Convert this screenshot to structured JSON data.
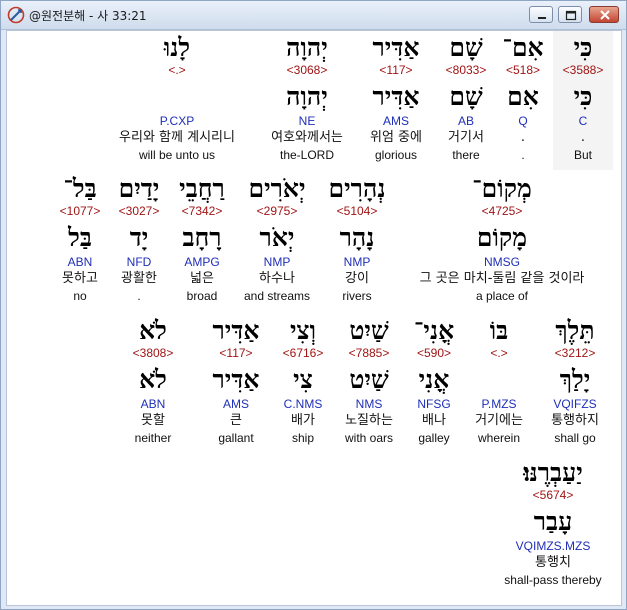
{
  "window": {
    "title": "@원전분해 - 사 33:21"
  },
  "verse": [
    {
      "cols": [
        {
          "heb": "כִּי",
          "strong": "<3588>",
          "heb2": "כִּי",
          "parse": "C",
          "kor": ".",
          "eng": "But"
        },
        {
          "heb": "אִם־",
          "strong": "<518>",
          "heb2": "אִם",
          "parse": "Q",
          "kor": ".",
          "eng": "."
        },
        {
          "heb": "שָׁם",
          "strong": "<8033>",
          "heb2": "שָׁם",
          "parse": "AB",
          "kor": "거기서",
          "eng": "there"
        },
        {
          "heb": "אַדִּיר",
          "strong": "<117>",
          "heb2": "אַדִּיר",
          "parse": "AMS",
          "kor": "위엄 중에",
          "eng": "glorious"
        },
        {
          "heb": "יְהוָה",
          "strong": "<3068>",
          "heb2": "יְהוָה",
          "parse": "NE",
          "kor": "여호와께서는",
          "eng": "the-LORD"
        },
        {
          "heb": "לָנוּ",
          "strong": "<.>",
          "heb2": "",
          "parse": "P.CXP",
          "kor": "우리와 함께 계시리니",
          "eng": "will be unto us"
        }
      ]
    },
    {
      "cols": [
        {
          "heb": "מְקוֹם־",
          "strong": "<4725>",
          "heb2": "מָקוֹם",
          "parse": "NMSG",
          "kor": "그 곳은 마치-둘림 같을 것이라",
          "eng": "a place of"
        },
        {
          "heb": "נְהָרִים",
          "strong": "<5104>",
          "heb2": "נָהָר",
          "parse": "NMP",
          "kor": "강이",
          "eng": "rivers"
        },
        {
          "heb": "יְאֹרִים",
          "strong": "<2975>",
          "heb2": "יְאֹר",
          "parse": "NMP",
          "kor": "하수나",
          "eng": "and streams"
        },
        {
          "heb": "רַחֲבֵי",
          "strong": "<7342>",
          "heb2": "רָחָב",
          "parse": "AMPG",
          "kor": "넓은",
          "eng": "broad"
        },
        {
          "heb": "יָדַיִם",
          "strong": "<3027>",
          "heb2": "יָד",
          "parse": "NFD",
          "kor": "광활한",
          "eng": "."
        },
        {
          "heb": "בַּל־",
          "strong": "<1077>",
          "heb2": "בַּל",
          "parse": "ABN",
          "kor": "못하고",
          "eng": "no"
        }
      ]
    },
    {
      "cols": [
        {
          "heb": "תֵּלֶךְ",
          "strong": "<3212>",
          "heb2": "יָלַךְ",
          "parse": "VQIFZS",
          "kor": "통행하지",
          "eng": "shall go"
        },
        {
          "heb": "בּוֹ",
          "strong": "<.>",
          "heb2": "",
          "parse": "P.MZS",
          "kor": "거기에는",
          "eng": "wherein"
        },
        {
          "heb": "אֳנִי־",
          "strong": "<590>",
          "heb2": "אֳנִי",
          "parse": "NFSG",
          "kor": "배나",
          "eng": "galley"
        },
        {
          "heb": "שַׁיִט",
          "strong": "<7885>",
          "heb2": "שַׁיִט",
          "parse": "NMS",
          "kor": "노질하는",
          "eng": "with oars"
        },
        {
          "heb": "וְצִי",
          "strong": "<6716>",
          "heb2": "צִי",
          "parse": "C.NMS",
          "kor": "배가",
          "eng": "ship"
        },
        {
          "heb": "אַדִּיר",
          "strong": "<117>",
          "heb2": "אַדִּיר",
          "parse": "AMS",
          "kor": "큰",
          "eng": "gallant"
        },
        {
          "heb": "לֹא",
          "strong": "<3808>",
          "heb2": "לֹא",
          "parse": "ABN",
          "kor": "못할",
          "eng": "neither"
        }
      ]
    },
    {
      "cols": [
        {
          "heb": "יַעַבְרֶנּוּ׃",
          "strong": "<5674>",
          "heb2": "עָבַר",
          "parse": "VQIMZS.MZS",
          "kor": "통행치",
          "eng": "shall-pass thereby"
        }
      ]
    }
  ]
}
